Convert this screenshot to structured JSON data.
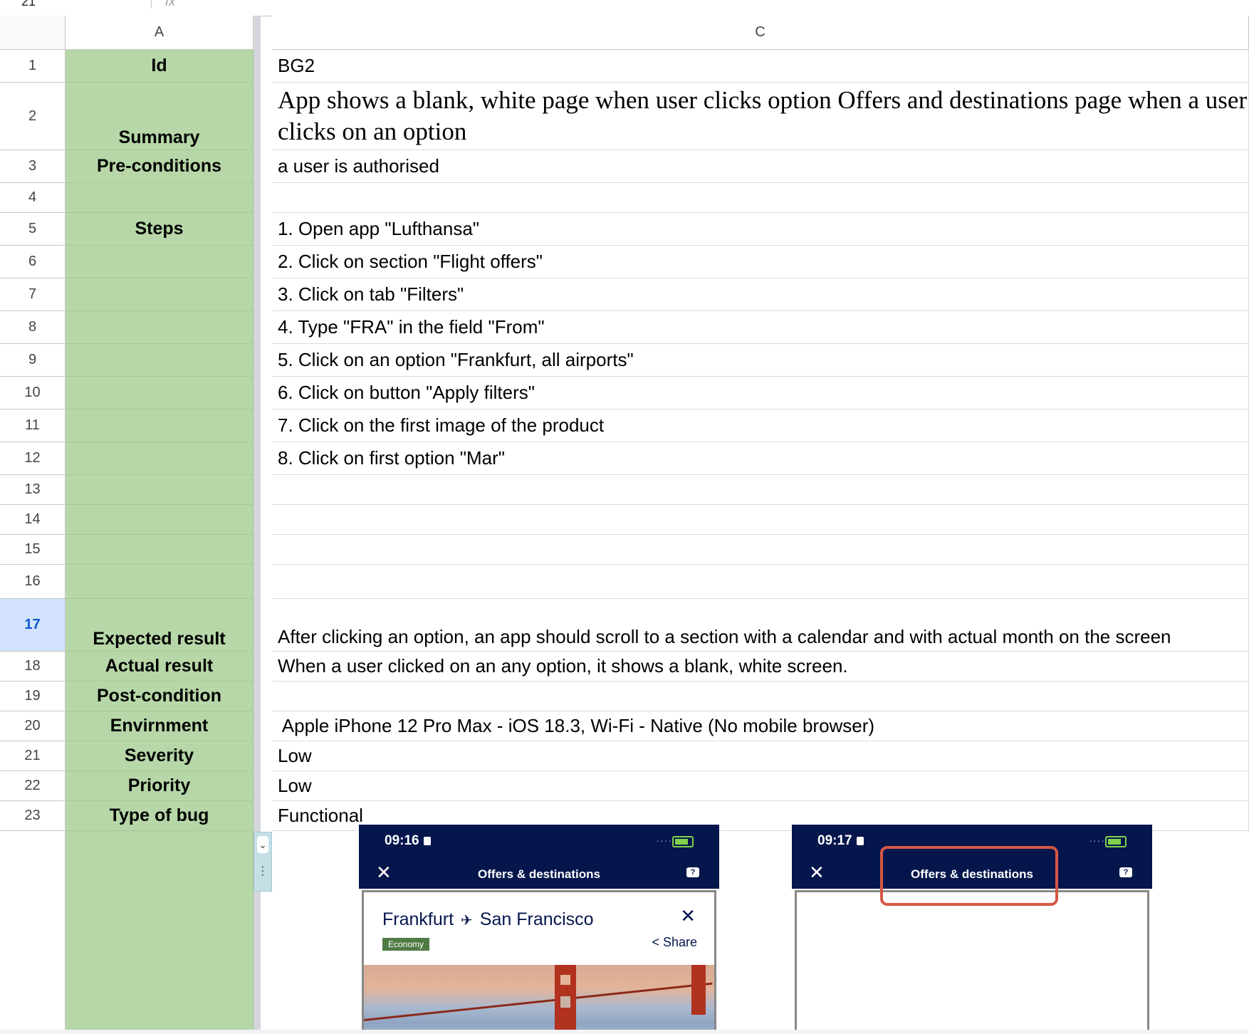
{
  "toolbar": {
    "cell_ref": "21",
    "fx": "fx"
  },
  "columns": [
    "A",
    "C"
  ],
  "rows": [
    {
      "n": "1",
      "label": "Id",
      "value": "BG2"
    },
    {
      "n": "2",
      "label": "Summary",
      "value": "App shows a blank, white page when user clicks option Offers and destinations page when a user clicks on an option"
    },
    {
      "n": "3",
      "label": "Pre-conditions",
      "value": "a user is authorised"
    },
    {
      "n": "4",
      "label": "",
      "value": ""
    },
    {
      "n": "5",
      "label": "Steps",
      "value": "1. Open app \"Lufthansa\""
    },
    {
      "n": "6",
      "label": "",
      "value": "2. Click on section \"Flight offers\""
    },
    {
      "n": "7",
      "label": "",
      "value": "3. Click on tab \"Filters\""
    },
    {
      "n": "8",
      "label": "",
      "value": "4. Type \"FRA\" in the field \"From\""
    },
    {
      "n": "9",
      "label": "",
      "value": "5. Click on an option \"Frankfurt, all airports\""
    },
    {
      "n": "10",
      "label": "",
      "value": "6. Click on button \"Apply filters\""
    },
    {
      "n": "11",
      "label": "",
      "value": "7. Click on the first image of the product"
    },
    {
      "n": "12",
      "label": "",
      "value": "8. Click on first option \"Mar\""
    },
    {
      "n": "13",
      "label": "",
      "value": ""
    },
    {
      "n": "14",
      "label": "",
      "value": ""
    },
    {
      "n": "15",
      "label": "",
      "value": ""
    },
    {
      "n": "16",
      "label": "",
      "value": ""
    },
    {
      "n": "17",
      "label": "Expected result",
      "value": "After clicking an option, an app should scroll to a section with a calendar and with actual month on the screen"
    },
    {
      "n": "18",
      "label": "Actual result",
      "value": "When a user clicked on an any option, it shows a blank, white screen."
    },
    {
      "n": "19",
      "label": "Post-condition",
      "value": ""
    },
    {
      "n": "20",
      "label": "Envirnment",
      "value": " Apple iPhone 12 Pro Max - iOS 18.3, Wi-Fi - Native (No mobile browser)"
    },
    {
      "n": "21",
      "label": "Severity",
      "value": "Low"
    },
    {
      "n": "22",
      "label": "Priority",
      "value": "Low"
    },
    {
      "n": "23",
      "label": "Type of bug",
      "value": "Functional"
    }
  ],
  "screenshot1": {
    "time": "09:16",
    "title": "Offers & destinations",
    "from": "Frankfurt",
    "to": "San Francisco",
    "cabin": "Economy",
    "share": "Share"
  },
  "screenshot2": {
    "time": "09:17",
    "title": "Offers & destinations"
  },
  "colors": {
    "label_bg": "#b7d7a8",
    "selected_row": "#d3e3fd",
    "app_header": "#05164d",
    "highlight": "#d65744"
  }
}
